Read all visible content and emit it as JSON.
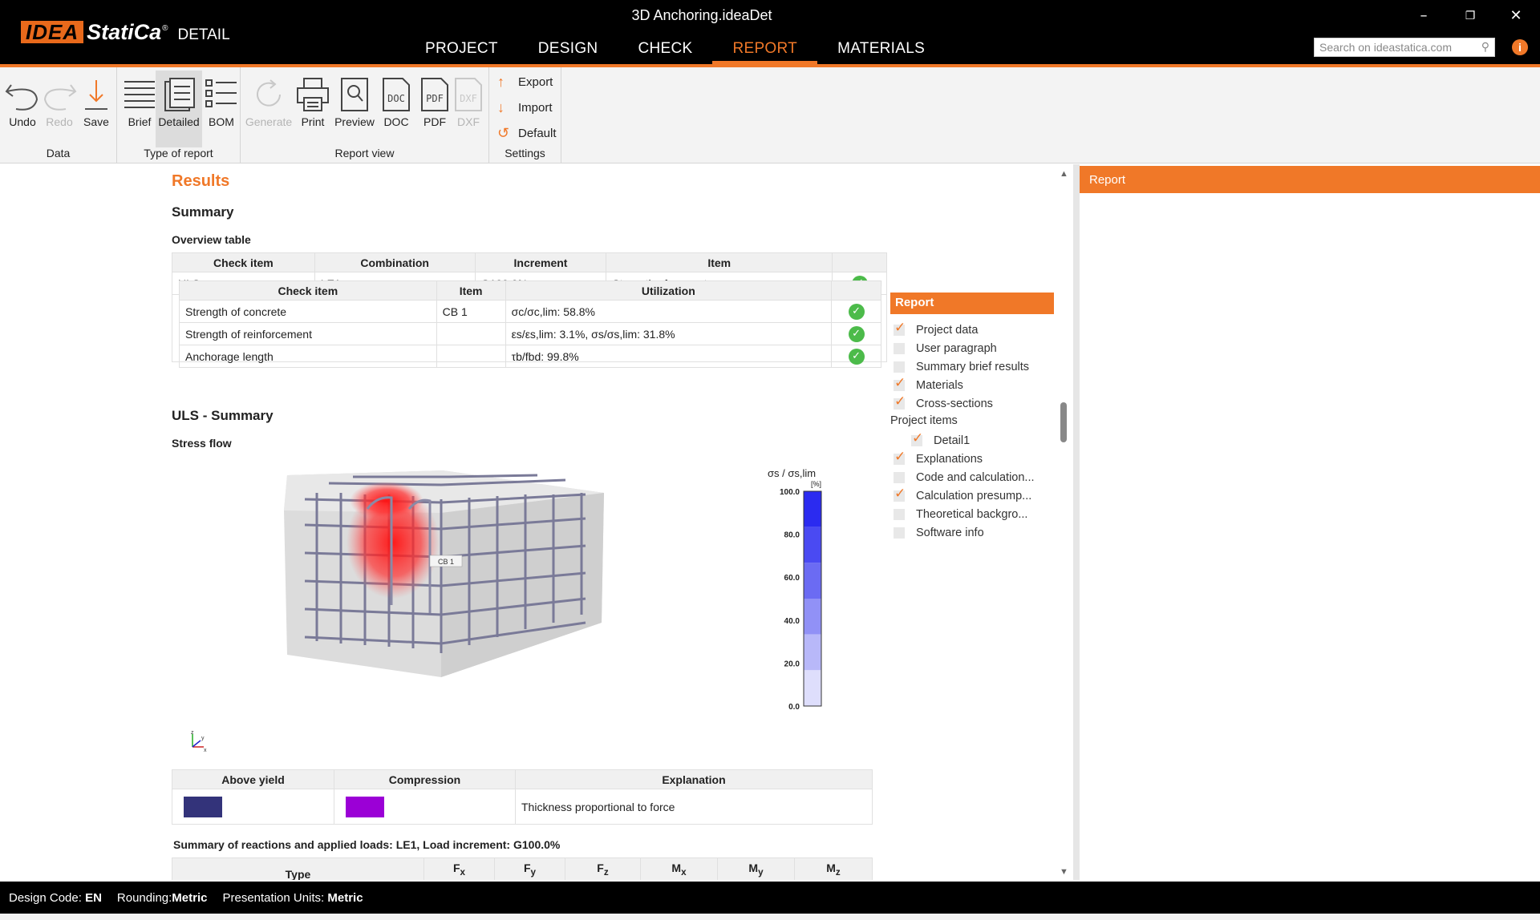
{
  "app": {
    "window_title": "3D Anchoring.ideaDet",
    "logo_idea": "IDEA",
    "logo_statica": "StatiCa",
    "logo_reg": "®",
    "logo_product": "DETAIL",
    "nav": [
      "PROJECT",
      "DESIGN",
      "CHECK",
      "REPORT",
      "MATERIALS"
    ],
    "active_nav": "REPORT",
    "search_placeholder": "Search on ideastatica.com",
    "accent_color": "#f07828"
  },
  "ribbon": {
    "groups": {
      "data": "Data",
      "type": "Type of report",
      "view": "Report view",
      "settings": "Settings"
    },
    "buttons": {
      "undo": "Undo",
      "redo": "Redo",
      "save": "Save",
      "brief": "Brief",
      "detailed": "Detailed",
      "bom": "BOM",
      "generate": "Generate",
      "print": "Print",
      "preview": "Preview",
      "doc": "DOC",
      "pdf": "PDF",
      "dxf": "DXF"
    },
    "settings": {
      "export": "Export",
      "import": "Import",
      "default": "Default"
    }
  },
  "report": {
    "results_title": "Results",
    "summary_title": "Summary",
    "overview_title": "Overview table",
    "overview": {
      "headers": [
        "Check item",
        "Combination",
        "Increment",
        "Item"
      ],
      "row": {
        "check_item": "ULS",
        "combination": "LE1",
        "increment": "G100.0%",
        "item": "Strength of concrete"
      }
    },
    "detail": {
      "headers": [
        "Check item",
        "Item",
        "Utilization"
      ],
      "rows": [
        {
          "check_item": "Strength of concrete",
          "item": "CB 1",
          "utilization": "σc/σc,lim: 58.8%"
        },
        {
          "check_item": "Strength of reinforcement",
          "item": "",
          "utilization": "εs/εs,lim: 3.1%, σs/σs,lim: 31.8%"
        },
        {
          "check_item": "Anchorage length",
          "item": "",
          "utilization": "τb/fbd: 99.8%"
        }
      ]
    },
    "uls_title": "ULS - Summary",
    "stress_flow_title": "Stress flow",
    "figure": {
      "member_label": "CB 1",
      "legend_title": "σs / σs,lim",
      "legend_unit": "[%]",
      "legend_ticks": [
        "100.0",
        "80.0",
        "60.0",
        "40.0",
        "20.0",
        "0.0"
      ],
      "legend_colors": [
        "#2b2bf0",
        "#4a4af2",
        "#6b6bf3",
        "#9191f6",
        "#b8b8f9",
        "#dedefc"
      ],
      "axis_labels": {
        "z": "z",
        "y": "y",
        "x": "x"
      }
    },
    "yield_table": {
      "headers": [
        "Above yield",
        "Compression",
        "Explanation"
      ],
      "above_yield_color": "#33337a",
      "compression_color": "#9b00d6",
      "explanation": "Thickness proportional to force"
    },
    "reactions_title": "Summary of reactions and applied loads: LE1, Load increment: G100.0%",
    "reactions_headers": [
      "Type",
      "F",
      "F",
      "F",
      "M",
      "M",
      "M"
    ],
    "reactions_subs": [
      "",
      "x",
      "y",
      "z",
      "x",
      "y",
      "z"
    ]
  },
  "report_options": {
    "header": "Report",
    "items": [
      {
        "label": "Project data",
        "checked": true
      },
      {
        "label": "User paragraph",
        "checked": false
      },
      {
        "label": "Summary brief results",
        "checked": false
      },
      {
        "label": "Materials",
        "checked": true
      },
      {
        "label": "Cross-sections",
        "checked": true
      },
      {
        "label": "Project items",
        "checked": null
      },
      {
        "label": "Detail1",
        "checked": true
      },
      {
        "label": "Explanations",
        "checked": true
      },
      {
        "label": "Code and calculation...",
        "checked": false
      },
      {
        "label": "Calculation presump...",
        "checked": true
      },
      {
        "label": "Theoretical backgro...",
        "checked": false
      },
      {
        "label": "Software info",
        "checked": false
      }
    ]
  },
  "right_panel": {
    "header": "Report"
  },
  "status": {
    "design_code_label": "Design Code:",
    "design_code": "EN",
    "rounding_label": "Rounding:",
    "rounding": "Metric",
    "units_label": "Presentation Units:",
    "units": "Metric"
  }
}
